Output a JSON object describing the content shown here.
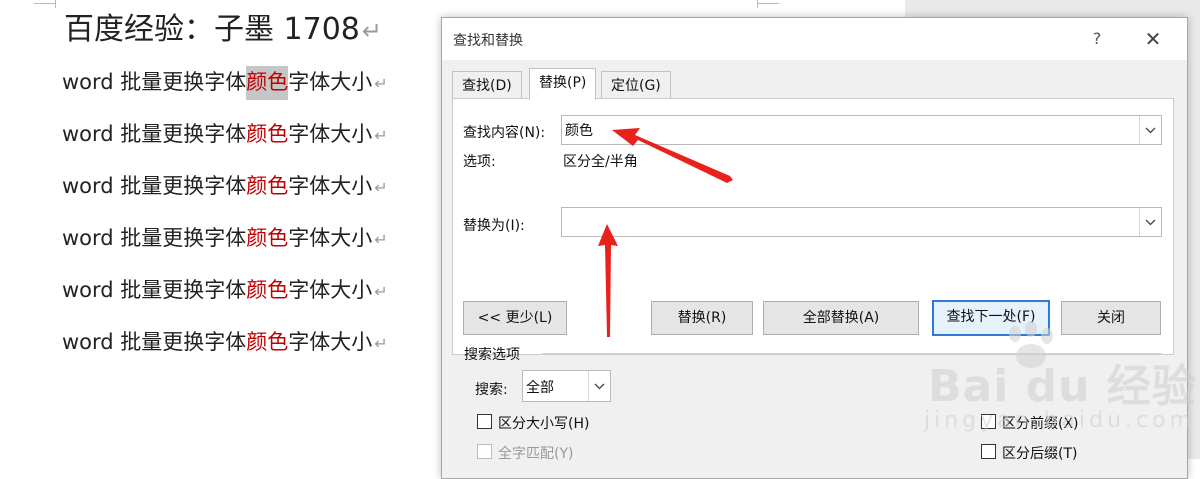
{
  "document": {
    "title": "百度经验：子墨 1708",
    "paragraph_mark": "↵",
    "lines": [
      {
        "before": "word 批量更换字体",
        "highlight": "颜色",
        "after": "字体大小",
        "selected": true
      },
      {
        "before": "word 批量更换字体",
        "highlight": "颜色",
        "after": "字体大小",
        "selected": false
      },
      {
        "before": "word 批量更换字体",
        "highlight": "颜色",
        "after": "字体大小",
        "selected": false
      },
      {
        "before": "word 批量更换字体",
        "highlight": "颜色",
        "after": "字体大小",
        "selected": false
      },
      {
        "before": "word 批量更换字体",
        "highlight": "颜色",
        "after": "字体大小",
        "selected": false
      },
      {
        "before": "word 批量更换字体",
        "highlight": "颜色",
        "after": "字体大小",
        "selected": false
      }
    ],
    "highlight_color": "#c00000"
  },
  "dialog": {
    "title": "查找和替换",
    "help": "?",
    "close": "✕",
    "tabs": [
      {
        "label": "查找(D)",
        "active": false
      },
      {
        "label": "替换(P)",
        "active": true
      },
      {
        "label": "定位(G)",
        "active": false
      }
    ],
    "find_label": "查找内容(N):",
    "find_value": "颜色",
    "options_label": "选项:",
    "options_value": "区分全/半角",
    "replace_label": "替换为(I):",
    "replace_value": "",
    "buttons": {
      "less": "<< 更少(L)",
      "replace": "替换(R)",
      "replace_all": "全部替换(A)",
      "find_next": "查找下一处(F)",
      "close": "关闭"
    },
    "search_options": {
      "heading": "搜索选项",
      "search_label": "搜索:",
      "search_value": "全部",
      "match_case": "区分大小写(H)",
      "whole_word": "全字匹配(Y)",
      "match_prefix": "区分前缀(X)",
      "match_suffix": "区分后缀(T)"
    },
    "accent_color": "#2f7ad6",
    "annotation_arrow_color": "#e8221b"
  },
  "watermark": {
    "logo": "Bai du 经验",
    "url": "jingyan.baidu.com"
  }
}
